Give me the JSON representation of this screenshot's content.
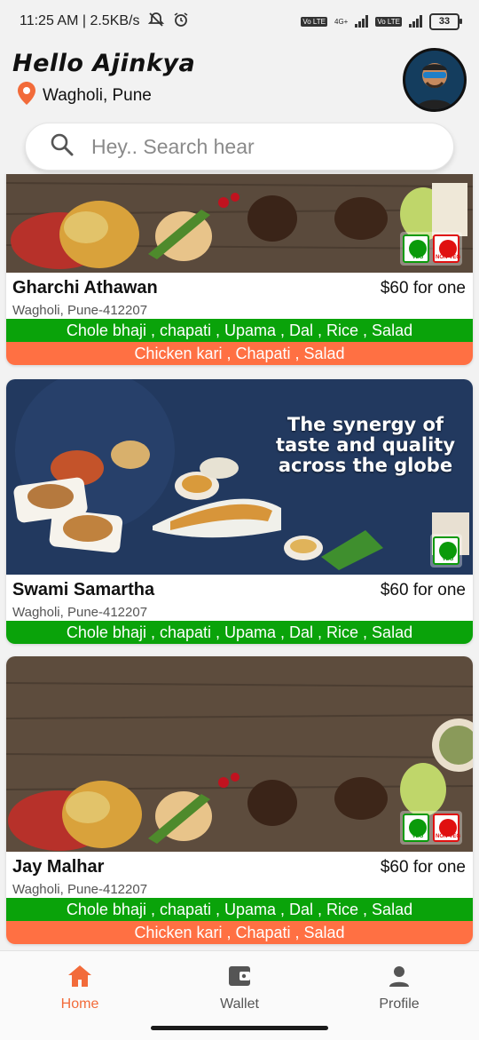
{
  "status_bar": {
    "time_speed": "11:25 AM | 2.5KB/s",
    "net_label_1": "Vo LTE",
    "net_label_2": "Vo LTE",
    "net_type": "4G+",
    "battery": "33"
  },
  "header": {
    "greeting": "Hello Ajinkya",
    "location": "Wagholi, Pune"
  },
  "search": {
    "placeholder": "Hey.. Search hear"
  },
  "restaurants": [
    {
      "name": "Gharchi Athawan",
      "price": "$60 for one",
      "address": "Wagholi, Pune-412207",
      "veg_menu": "Chole bhaji , chapati , Upama , Dal , Rice , Salad",
      "nonveg_menu": "Chicken kari , Chapati , Salad",
      "badges": [
        "VEG",
        "NON-VEG"
      ]
    },
    {
      "name": "Swami Samartha",
      "price": "$60 for one",
      "address": "Wagholi, Pune-412207",
      "veg_menu": "Chole bhaji , chapati , Upama , Dal , Rice , Salad",
      "headline": "The synergy of taste and quality across the globe",
      "badges": [
        "VEG"
      ]
    },
    {
      "name": "Jay Malhar",
      "price": "$60 for one",
      "address": "Wagholi, Pune-412207",
      "veg_menu": "Chole bhaji , chapati , Upama , Dal , Rice , Salad",
      "nonveg_menu": "Chicken kari , Chapati , Salad",
      "badges": [
        "VEG",
        "NON-VEG"
      ]
    }
  ],
  "nav": {
    "home": "Home",
    "wallet": "Wallet",
    "profile": "Profile",
    "active_color": "#f26b3a"
  },
  "colors": {
    "veg_bar": "#0aa30a",
    "nonveg_bar": "#ff7043"
  }
}
